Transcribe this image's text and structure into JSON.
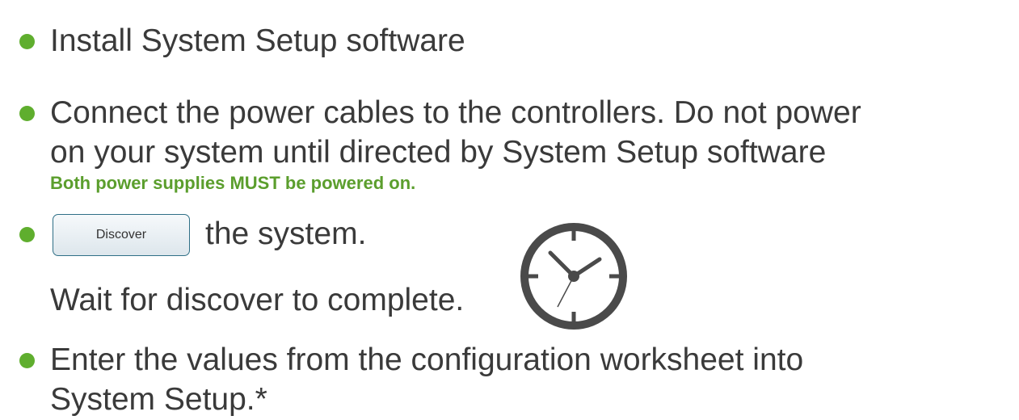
{
  "steps": [
    {
      "text": "Install System Setup software"
    },
    {
      "lines": [
        "Connect the power cables to the controllers. Do not power",
        "on your system until directed by System Setup software"
      ],
      "note": "Both power supplies MUST be powered on."
    },
    {
      "button_label": "Discover",
      "after_text": "the system.",
      "wait_text": "Wait for discover to complete."
    },
    {
      "lines": [
        "Enter the values from the configuration worksheet into",
        "System Setup.*"
      ]
    }
  ],
  "colors": {
    "bullet": "#5fae2e",
    "note": "#5b9e2d",
    "clock": "#4a4a4a"
  },
  "icons": {
    "wait": "clock-icon"
  }
}
